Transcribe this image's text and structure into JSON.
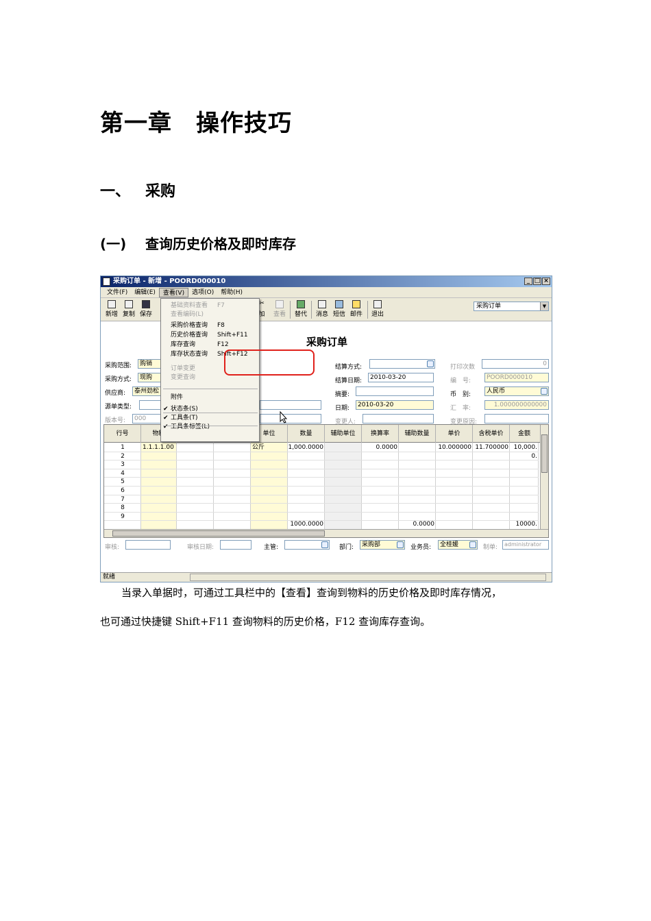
{
  "doc": {
    "chapter_title": "第一章　操作技巧",
    "section_num": "一、",
    "section_title": "采购",
    "subsection_num": "(一)",
    "subsection_title": "查询历史价格及即时库存",
    "para1": "当录入单据时，可通过工具栏中的【查看】查询到物料的历史价格及即时库存情况，",
    "para2": "也可通过快捷键 Shift+F11 查询物料的历史价格，F12 查询库存查询。"
  },
  "window": {
    "title": "采购订单 - 新增 - POORD000010",
    "btn_min": "_",
    "btn_max": "□",
    "btn_close": "×",
    "menu": [
      "文件(F)",
      "编辑(E)",
      "查看(V)",
      "选项(O)",
      "帮助(H)"
    ],
    "toolbar_left": [
      "新增",
      "复制",
      "保存"
    ],
    "toolbar_right": [
      "加",
      "查看",
      "替代",
      "消息",
      "短信",
      "邮件",
      "退出"
    ],
    "toolbar_select": "采购订单",
    "status": "就绪"
  },
  "dropdown": {
    "items": [
      {
        "label": "基础资料查看",
        "shortcut": "F7",
        "disabled": true
      },
      {
        "label": "查看编码(L)",
        "shortcut": "",
        "disabled": true
      },
      {
        "label": "采购价格查询",
        "shortcut": "F8",
        "disabled": false
      },
      {
        "label": "历史价格查询",
        "shortcut": "Shift+F11",
        "disabled": false
      },
      {
        "label": "库存查询",
        "shortcut": "F12",
        "disabled": false
      },
      {
        "label": "库存状态查询",
        "shortcut": "Shift+F12",
        "disabled": false
      },
      {
        "label": "订单变更",
        "shortcut": "",
        "disabled": true
      },
      {
        "label": "变更查询",
        "shortcut": "",
        "disabled": true
      },
      {
        "label": "附件",
        "shortcut": "",
        "disabled": false
      },
      {
        "label": "状态条(S)",
        "shortcut": "",
        "disabled": false
      },
      {
        "label": "工具条(T)",
        "shortcut": "",
        "disabled": false
      },
      {
        "label": "工具条标签(L)",
        "shortcut": "",
        "disabled": false
      }
    ],
    "checkmark": "✔"
  },
  "form": {
    "title": "采购订单",
    "purchase_scope_label": "采购范围:",
    "purchase_scope_value": "购销",
    "purchase_method_label": "采购方式:",
    "purchase_method_value": "现购",
    "supplier_label": "供应商:",
    "supplier_value": "泰州劲松",
    "source_type_label": "源单类型:",
    "version_label": "版本号:",
    "version_value": "000",
    "settle_method_label": "结算方式:",
    "settle_date_label": "结算日期:",
    "settle_date_value": "2010-03-20",
    "summary_label": "摘要:",
    "date_label": "日期:",
    "date_value": "2010-03-20",
    "changer_label": "变更人:",
    "print_count_label": "打印次数",
    "print_count_value": "0",
    "number_label": "编　号:",
    "number_value": "POORD000010",
    "currency_label": "币　别:",
    "currency_value": "人民币",
    "rate_label": "汇　率:",
    "rate_value": "1.000000000000",
    "change_reason_label": "变更原因:"
  },
  "grid": {
    "headers": [
      "行号",
      "物料",
      "",
      "",
      "单位",
      "数量",
      "辅助单位",
      "换算率",
      "辅助数量",
      "单价",
      "含税单价",
      "金额"
    ],
    "rows": [
      {
        "no": "1",
        "item": "1.1.1.1.00",
        "unit": "公斤",
        "qty": "1,000.0000",
        "rate": "0.0000",
        "price": "10.000000",
        "tax_price": "11.700000",
        "amount": "10,000."
      },
      {
        "no": "2",
        "amount": "0."
      },
      {
        "no": "3"
      },
      {
        "no": "4"
      },
      {
        "no": "5"
      },
      {
        "no": "6"
      },
      {
        "no": "7"
      },
      {
        "no": "8"
      },
      {
        "no": "9"
      }
    ],
    "total_qty": "1000.0000",
    "total_aux": "0.0000",
    "total_amount": "10000."
  },
  "footer": {
    "audit_label": "审核:",
    "audit_date_label": "审核日期:",
    "supervisor_label": "主管:",
    "dept_label": "部门:",
    "dept_value": "采购部",
    "clerk_label": "业务员:",
    "clerk_value": "全桂媛",
    "maker_label": "制单:",
    "maker_value": "administrator"
  }
}
